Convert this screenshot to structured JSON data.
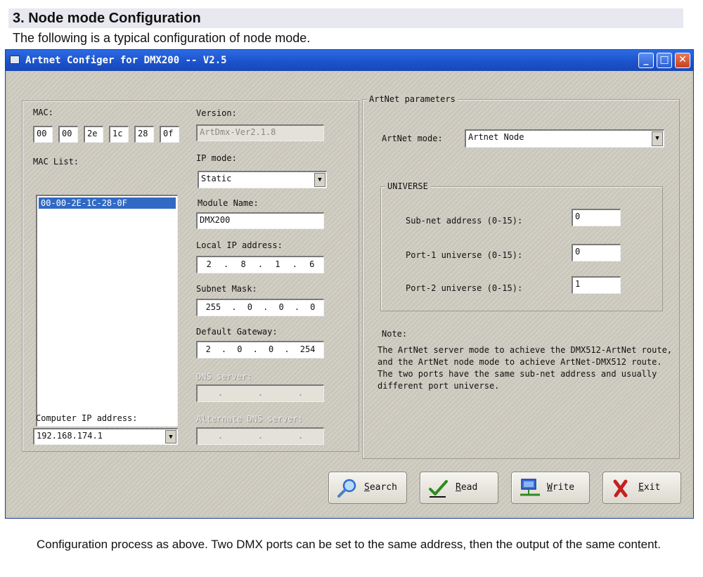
{
  "doc": {
    "heading": "3. Node mode Configuration",
    "intro": "The following is a typical configuration of node mode.",
    "footer": "Configuration process as above. Two DMX ports can be set to the same address, then the output of the same content."
  },
  "window": {
    "title": "Artnet Configer for DMX200 -- V2.5",
    "controls": {
      "minimize": "_",
      "maximize": "□",
      "close": "✕"
    }
  },
  "left": {
    "mac_label": "MAC:",
    "mac_octets": [
      "00",
      "00",
      "2e",
      "1c",
      "28",
      "0f"
    ],
    "mac_list_label": "MAC List:",
    "mac_list": [
      "00-00-2E-1C-28-0F"
    ],
    "computer_ip_label": "Computer IP address:",
    "computer_ip": "192.168.174.1"
  },
  "middle": {
    "version_label": "Version:",
    "version_value": "ArtDmx-Ver2.1.8",
    "ip_mode_label": "IP mode:",
    "ip_mode_value": "Static",
    "module_name_label": "Module Name:",
    "module_name_value": "DMX200",
    "local_ip_label": "Local IP address:",
    "local_ip": [
      "2",
      "8",
      "1",
      "6"
    ],
    "subnet_label": "Subnet Mask:",
    "subnet": [
      "255",
      "0",
      "0",
      "0"
    ],
    "gateway_label": "Default Gateway:",
    "gateway": [
      "2",
      "0",
      "0",
      "254"
    ],
    "dns_label": "DNS server:",
    "alt_dns_label": "Alternate DNS server:",
    "ip_separator": "."
  },
  "artnet": {
    "group_label": "ArtNet parameters",
    "mode_label": "ArtNet mode:",
    "mode_value": "Artnet Node",
    "universe_label": "UNIVERSE",
    "subnet_label": "Sub-net address (0-15):",
    "subnet_value": "0",
    "port1_label": "Port-1 universe (0-15):",
    "port1_value": "0",
    "port2_label": "Port-2 universe (0-15):",
    "port2_value": "1",
    "note_label": "Note:",
    "note_text": "The ArtNet server mode to achieve the DMX512-ArtNet route, and the ArtNet node mode to achieve ArtNet-DMX512 route. The two ports have the same sub-net address and usually different port universe."
  },
  "buttons": {
    "search": "Search",
    "read": "Read",
    "write": "Write",
    "exit": "Exit"
  }
}
